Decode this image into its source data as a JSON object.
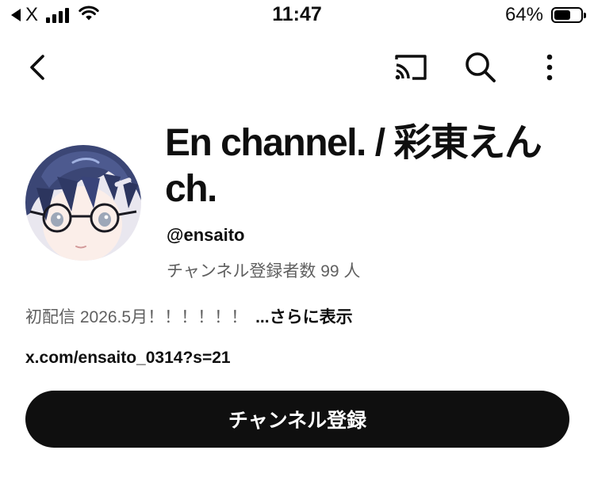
{
  "status_bar": {
    "carrier": "X",
    "time": "11:47",
    "battery_percent": "64%",
    "battery_level": 0.64,
    "icons": [
      "back-to-app-icon",
      "signal-icon",
      "wifi-icon",
      "battery-icon"
    ]
  },
  "app_bar": {
    "icons": [
      "back-arrow-icon",
      "cast-icon",
      "search-icon",
      "more-vertical-icon"
    ]
  },
  "channel": {
    "name": "En channel. / 彩東えん ch.",
    "handle": "@ensaito",
    "subscribers": "チャンネル登録者数 99 人",
    "description": "初配信 2026.5月！！！！！！",
    "more_label": "...さらに表示",
    "link": "x.com/ensaito_0314?s=21",
    "subscribe_label": "チャンネル登録"
  },
  "colors": {
    "primary_text": "#0f0f0f",
    "secondary_text": "#606060",
    "button_bg": "#0f0f0f",
    "button_text": "#ffffff",
    "background": "#ffffff"
  }
}
